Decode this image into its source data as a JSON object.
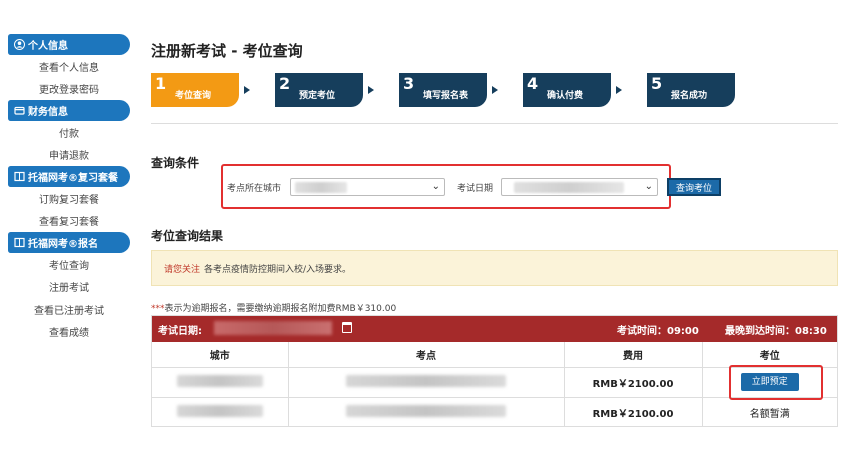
{
  "sidebar": {
    "sections": [
      {
        "title": "个人信息",
        "icon": "user-icon",
        "items": [
          "查看个人信息",
          "更改登录密码"
        ]
      },
      {
        "title": "财务信息",
        "icon": "wallet-icon",
        "items": [
          "付款",
          "申请退款"
        ]
      },
      {
        "title": "托福网考®复习套餐",
        "icon": "book-icon",
        "items": [
          "订购复习套餐",
          "查看复习套餐"
        ]
      },
      {
        "title": "托福网考®报名",
        "icon": "book-icon",
        "items": [
          "考位查询",
          "注册考试",
          "查看已注册考试",
          "查看成绩"
        ]
      }
    ]
  },
  "main": {
    "title": "注册新考试 - 考位查询",
    "steps": [
      {
        "num": "1",
        "label": "考位查询",
        "active": true
      },
      {
        "num": "2",
        "label": "预定考位",
        "active": false
      },
      {
        "num": "3",
        "label": "填写报名表",
        "active": false
      },
      {
        "num": "4",
        "label": "确认付费",
        "active": false
      },
      {
        "num": "5",
        "label": "报名成功",
        "active": false
      }
    ],
    "query": {
      "section_title": "查询条件",
      "city_label": "考点所在城市",
      "date_label": "考试日期",
      "button": "查询考位"
    },
    "results": {
      "section_title": "考位查询结果",
      "notice_highlight": "请您关注",
      "notice_text": "各考点疫情防控期间入校/入场要求。",
      "footnote_star": "***",
      "footnote_text": "表示为逾期报名，需要缴纳逾期报名附加费RMB￥310.00",
      "exam_date_label": "考试日期:",
      "exam_time": "考试时间：09:00",
      "latest_arrival": "最晚到达时间：08:30",
      "columns": [
        "城市",
        "考点",
        "费用",
        "考位"
      ],
      "rows": [
        {
          "fee": "RMB￥2100.00",
          "seat": "立即预定",
          "bookable": true
        },
        {
          "fee": "RMB￥2100.00",
          "seat": "名额暂满",
          "bookable": false
        }
      ]
    }
  },
  "colors": {
    "sidebar_blue": "#1d76bd",
    "step_active": "#f39a14",
    "step_inactive": "#163e5c",
    "result_header": "#a52a2a",
    "highlight_red": "#e23030"
  }
}
